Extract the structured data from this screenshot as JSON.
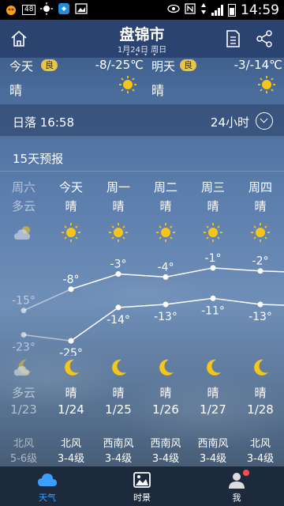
{
  "status_bar": {
    "notif_box": "48",
    "time": "14:59"
  },
  "header": {
    "city": "盘锦市",
    "date": "1月24日 周日",
    "page_dots": "• • • •"
  },
  "today": {
    "label": "今天",
    "aqi": "良",
    "range": "-8/-25℃",
    "condition": "晴"
  },
  "tomorrow": {
    "label": "明天",
    "aqi": "良",
    "range": "-3/-14℃",
    "condition": "晴"
  },
  "sunset": {
    "label": "日落 16:58",
    "hours_label": "24小时"
  },
  "forecast": {
    "title": "15天预报",
    "days": [
      {
        "name": "周六",
        "day_cond": "多云",
        "high": "-15°",
        "low": "-23°",
        "night_cond": "多云",
        "date": "1/23",
        "wind_dir": "北风",
        "wind_lvl": "5-6级",
        "past": true,
        "day_icon": "cloudy-sun-icon",
        "night_icon": "cloudy-moon-icon"
      },
      {
        "name": "今天",
        "day_cond": "晴",
        "high": "-8°",
        "low": "-25°",
        "night_cond": "晴",
        "date": "1/24",
        "wind_dir": "北风",
        "wind_lvl": "3-4级",
        "past": false,
        "day_icon": "sun-icon",
        "night_icon": "moon-icon"
      },
      {
        "name": "周一",
        "day_cond": "晴",
        "high": "-3°",
        "low": "-14°",
        "night_cond": "晴",
        "date": "1/25",
        "wind_dir": "西南风",
        "wind_lvl": "3-4级",
        "past": false,
        "day_icon": "sun-icon",
        "night_icon": "moon-icon"
      },
      {
        "name": "周二",
        "day_cond": "晴",
        "high": "-4°",
        "low": "-13°",
        "night_cond": "晴",
        "date": "1/26",
        "wind_dir": "西南风",
        "wind_lvl": "3-4级",
        "past": false,
        "day_icon": "sun-icon",
        "night_icon": "moon-icon"
      },
      {
        "name": "周三",
        "day_cond": "晴",
        "high": "-1°",
        "low": "-11°",
        "night_cond": "晴",
        "date": "1/27",
        "wind_dir": "西南风",
        "wind_lvl": "3-4级",
        "past": false,
        "day_icon": "sun-icon",
        "night_icon": "moon-icon"
      },
      {
        "name": "周四",
        "day_cond": "晴",
        "high": "-2°",
        "low": "-13°",
        "night_cond": "晴",
        "date": "1/28",
        "wind_dir": "北风",
        "wind_lvl": "3-4级",
        "past": false,
        "day_icon": "sun-icon",
        "night_icon": "moon-icon"
      }
    ],
    "highs": [
      -15,
      -8,
      -3,
      -4,
      -1,
      -2
    ],
    "lows": [
      -23,
      -25,
      -14,
      -13,
      -11,
      -13
    ]
  },
  "tabs": [
    {
      "label": "天气",
      "icon": "cloud-icon",
      "active": true
    },
    {
      "label": "时景",
      "icon": "picture-icon",
      "active": false
    },
    {
      "label": "我",
      "icon": "person-icon",
      "active": false
    }
  ],
  "colors": {
    "accent": "#3aa0ff",
    "aqi_badge": "#e6c547",
    "sun": "#f5c518",
    "header": "#2a4371"
  }
}
